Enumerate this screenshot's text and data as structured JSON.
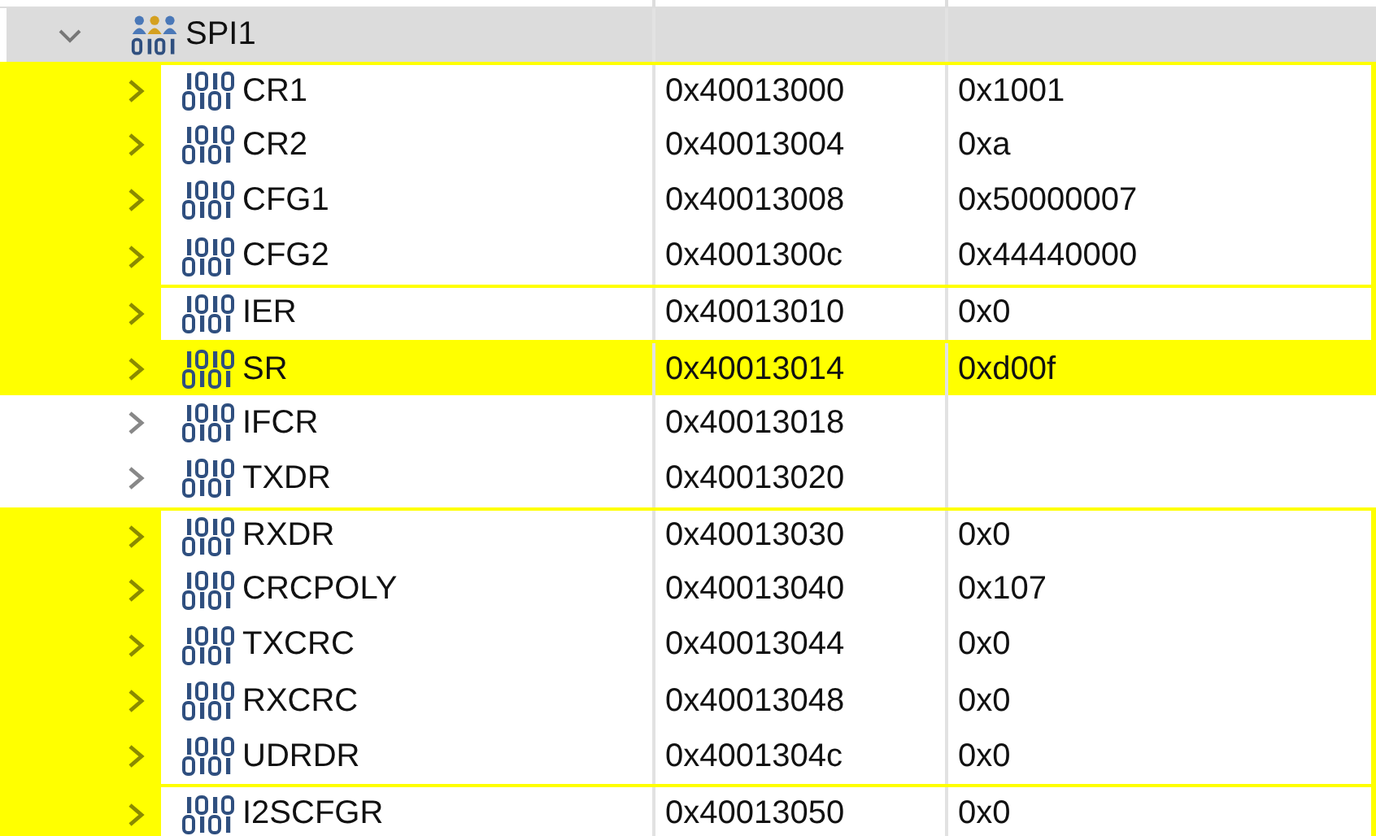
{
  "group": {
    "name": "SPI1",
    "expanded": true
  },
  "registers": [
    {
      "name": "CR1",
      "address": "0x40013000",
      "value": "0x1001",
      "changed": true,
      "selected": false
    },
    {
      "name": "CR2",
      "address": "0x40013004",
      "value": "0xa",
      "changed": true,
      "selected": false
    },
    {
      "name": "CFG1",
      "address": "0x40013008",
      "value": "0x50000007",
      "changed": true,
      "selected": false
    },
    {
      "name": "CFG2",
      "address": "0x4001300c",
      "value": "0x44440000",
      "changed": true,
      "selected": false
    },
    {
      "name": "IER",
      "address": "0x40013010",
      "value": "0x0",
      "changed": true,
      "selected": false
    },
    {
      "name": "SR",
      "address": "0x40013014",
      "value": "0xd00f",
      "changed": true,
      "selected": true
    },
    {
      "name": "IFCR",
      "address": "0x40013018",
      "changed": false,
      "selected": false
    },
    {
      "name": "TXDR",
      "address": "0x40013020",
      "changed": false,
      "selected": false
    },
    {
      "name": "RXDR",
      "address": "0x40013030",
      "value": "0x0",
      "changed": true,
      "selected": false
    },
    {
      "name": "CRCPOLY",
      "address": "0x40013040",
      "value": "0x107",
      "changed": true,
      "selected": false
    },
    {
      "name": "TXCRC",
      "address": "0x40013044",
      "value": "0x0",
      "changed": true,
      "selected": false
    },
    {
      "name": "RXCRC",
      "address": "0x40013048",
      "value": "0x0",
      "changed": true,
      "selected": false
    },
    {
      "name": "UDRDR",
      "address": "0x4001304c",
      "value": "0x0",
      "changed": true,
      "selected": false
    },
    {
      "name": "I2SCFGR",
      "address": "0x40013050",
      "value": "0x0",
      "changed": true,
      "selected": false
    }
  ]
}
